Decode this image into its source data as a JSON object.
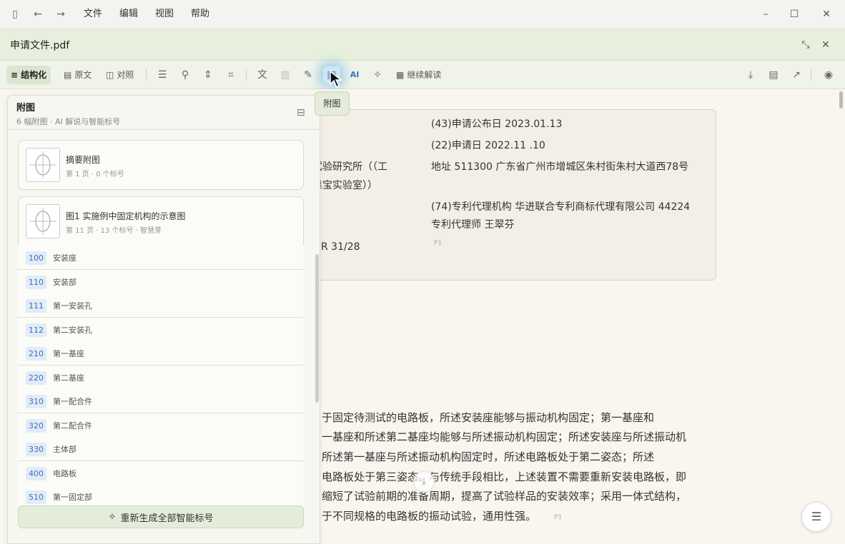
{
  "menu": [
    "文件",
    "编辑",
    "视图",
    "帮助"
  ],
  "doc": {
    "title": "申请文件.pdf"
  },
  "toolbar": {
    "structured": "结构化",
    "original": "原文",
    "compare": "对照",
    "ai": "AI",
    "continue": "继续解读"
  },
  "tooltip": "附图",
  "panel": {
    "title": "附图",
    "subtitle": "6 幅附图 · AI 解说与智能标号",
    "cards": [
      {
        "title": "摘要附图",
        "meta": "第 1 页 · 0 个标号"
      },
      {
        "title": "图1 实施例中固定机构的示意图",
        "meta": "第 11 页 · 13 个标号 · 智慧芽"
      }
    ],
    "rows": [
      {
        "num": "100",
        "label": "安装座"
      },
      {
        "num": "110",
        "label": "安装部"
      },
      {
        "num": "111",
        "label": "第一安装孔"
      },
      {
        "num": "112",
        "label": "第二安装孔"
      },
      {
        "num": "210",
        "label": "第一基座"
      },
      {
        "num": "220",
        "label": "第二基座"
      },
      {
        "num": "310",
        "label": "第一配合件"
      },
      {
        "num": "320",
        "label": "第二配合件"
      },
      {
        "num": "330",
        "label": "主体部"
      },
      {
        "num": "400",
        "label": "电路板"
      },
      {
        "num": "510",
        "label": "第一固定部"
      }
    ],
    "regen": "重新生成全部智能标号"
  },
  "info": {
    "l1": "(43)申请公布日 2023.01.13",
    "l2": "(22)申请日 2022.11 .10",
    "l3left": "试验研究所（（工",
    "l3right": "地址 511300 广东省广州市增城区朱村街朱村大道西78号",
    "l4left": "靠宝实验室））",
    "l5": "(74)专利代理机构 华进联合专利商标代理有限公司 44224",
    "l6": "专利代理师 王翠芬",
    "l7left": "R 31/28",
    "pageref": "P1"
  },
  "body": [
    "于固定待测试的电路板，所述安装座能够与振动机构固定；第一基座和",
    "一基座和所述第二基座均能够与所述振动机构固定；所述安装座与所述振动机",
    "所述第一基座与所述振动机构固定时，所述电路板处于第二姿态；所述",
    "电路板处于第三姿态。与传统手段相比，上述装置不需要重新安装电路板，即",
    "缩短了试验前期的准备周期，提高了试验样品的安装效率；采用一体式结构，",
    "于不同规格的电路板的振动试验，通用性强。"
  ],
  "body_pageref": "P1",
  "colors": {
    "accent": "#3a72b8",
    "header": "#e8f0dd",
    "highlight": "#4aa3e8"
  }
}
